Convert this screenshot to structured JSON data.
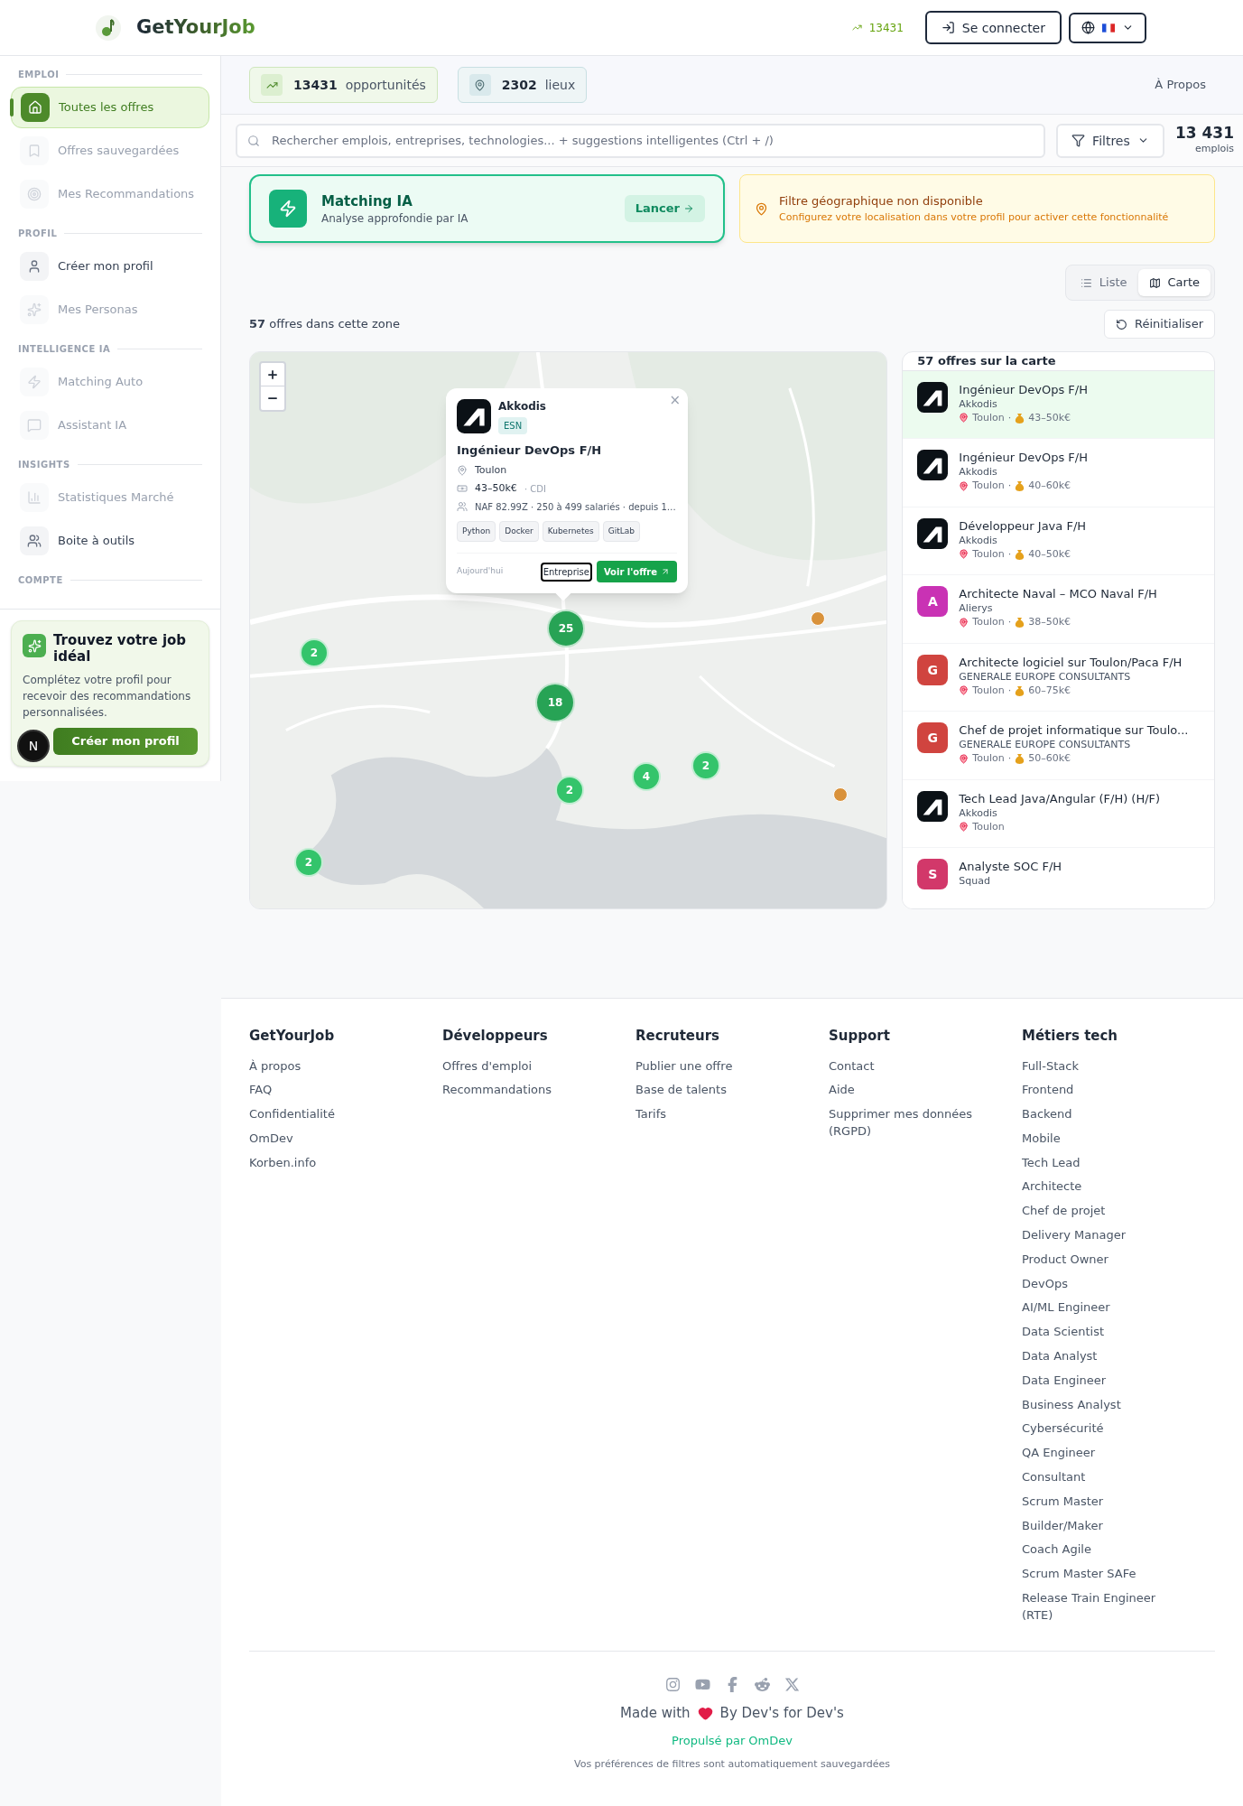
{
  "header": {
    "brand": "GetYourJob",
    "counter": "13431",
    "login": "Se connecter"
  },
  "sidebar": {
    "sections": [
      {
        "title": "EMPLOI",
        "items": [
          {
            "label": "Toutes les offres",
            "selected": true,
            "disabled": false
          },
          {
            "label": "Offres sauvegardées",
            "selected": false,
            "disabled": true
          },
          {
            "label": "Mes Recommandations",
            "selected": false,
            "disabled": true
          }
        ]
      },
      {
        "title": "PROFIL",
        "items": [
          {
            "label": "Créer mon profil",
            "selected": false,
            "disabled": false
          },
          {
            "label": "Mes Personas",
            "selected": false,
            "disabled": true
          }
        ]
      },
      {
        "title": "INTELLIGENCE IA",
        "items": [
          {
            "label": "Matching Auto",
            "selected": false,
            "disabled": true
          },
          {
            "label": "Assistant IA",
            "selected": false,
            "disabled": true
          }
        ]
      },
      {
        "title": "INSIGHTS",
        "items": [
          {
            "label": "Statistiques Marché",
            "selected": false,
            "disabled": true
          },
          {
            "label": "Boite à outils",
            "selected": false,
            "disabled": false
          }
        ]
      },
      {
        "title": "COMPTE"
      }
    ],
    "promo": {
      "title": "Trouvez votre job idéal",
      "text": "Complétez votre profil pour recevoir des recommandations personnalisées.",
      "button": "Créer mon profil"
    },
    "dev_badge": "N"
  },
  "stats": [
    {
      "value": "13431",
      "label": "opportunités"
    },
    {
      "value": "2302",
      "label": "lieux"
    }
  ],
  "about_link": "À Propos",
  "search": {
    "placeholder": "Rechercher emplois, entreprises, technologies... + suggestions intelligentes (Ctrl + /)",
    "filters": "Filtres",
    "total": "13 431",
    "total_label": "emplois"
  },
  "matching": {
    "title": "Matching IA",
    "subtitle": "Analyse approfondie par IA",
    "button": "Lancer"
  },
  "alert": {
    "title": "Filtre géographique non disponible",
    "text": "Configurez votre localisation dans votre profil pour activer cette fonctionnalité"
  },
  "view_toggle": [
    {
      "label": "Liste",
      "selected": false
    },
    {
      "label": "Carte",
      "selected": true
    }
  ],
  "results_count": "**57** offres dans cette zone",
  "reset": "Réinitialiser",
  "map": {
    "pins": [
      {
        "kind": "cluster",
        "count": "25"
      },
      {
        "kind": "cluster",
        "count": "2"
      },
      {
        "kind": "cluster",
        "count": "18"
      },
      {
        "kind": "cluster",
        "count": "2"
      },
      {
        "kind": "cluster",
        "count": "4"
      },
      {
        "kind": "cluster",
        "count": "2"
      },
      {
        "kind": "cluster",
        "count": "2"
      },
      {
        "kind": "single"
      },
      {
        "kind": "single"
      }
    ],
    "popup": {
      "company": "Akkodis",
      "tag": "ESN",
      "title": "Ingénieur DevOps F/H",
      "location": "Toulon",
      "salary": "43–50k€",
      "contract": "· CDI",
      "details": "NAF 82.99Z · 250 à 499 salariés · depuis 1…",
      "skills": [
        "Python",
        "Docker",
        "Kubernetes",
        "GitLab"
      ],
      "date": "Aujourd'hui",
      "company_button": "Entreprise",
      "offer_button": "Voir l'offre",
      "close": "×"
    }
  },
  "list": {
    "title": "57 offres sur la carte",
    "separator": "·",
    "items": [
      {
        "title": "Ingénieur DevOps F/H",
        "company": "Akkodis",
        "location": "Toulon",
        "salary": "43–50k€",
        "selected": true,
        "logo": {
          "kind": "mark"
        }
      },
      {
        "title": "Ingénieur DevOps F/H",
        "company": "Akkodis",
        "location": "Toulon",
        "salary": "40–60k€",
        "selected": false,
        "logo": {
          "kind": "mark"
        }
      },
      {
        "title": "Développeur Java F/H",
        "company": "Akkodis",
        "location": "Toulon",
        "salary": "40–50k€",
        "selected": false,
        "logo": {
          "kind": "mark"
        }
      },
      {
        "title": "Architecte Naval – MCO Naval F/H",
        "company": "Alierys",
        "location": "Toulon",
        "salary": "38–50k€",
        "selected": false,
        "logo": {
          "kind": "letter",
          "letter": "A",
          "color": "#c932b4"
        }
      },
      {
        "title": "Architecte logiciel sur Toulon/Paca F/H",
        "company": "GENERALE EUROPE CONSULTANTS",
        "location": "Toulon",
        "salary": "60–75k€",
        "selected": false,
        "logo": {
          "kind": "letter",
          "letter": "G",
          "color": "#d0443f"
        }
      },
      {
        "title": "Chef de projet informatique sur Toulo...",
        "company": "GENERALE EUROPE CONSULTANTS",
        "location": "Toulon",
        "salary": "50–60k€",
        "selected": false,
        "logo": {
          "kind": "letter",
          "letter": "G",
          "color": "#d0443f"
        }
      },
      {
        "title": "Tech Lead Java/Angular (F/H) (H/F)",
        "company": "Akkodis",
        "location": "Toulon",
        "selected": false,
        "logo": {
          "kind": "mark"
        }
      },
      {
        "title": "Analyste SOC F/H",
        "company": "Squad",
        "selected": false,
        "logo": {
          "kind": "letter",
          "letter": "S",
          "color": "#d2386a"
        }
      }
    ]
  },
  "footer": {
    "columns": [
      {
        "title": "GetYourJob",
        "links": [
          "À propos",
          "FAQ",
          "Confidentialité",
          "OmDev",
          "Korben.info"
        ]
      },
      {
        "title": "Développeurs",
        "links": [
          "Offres d'emploi",
          "Recommandations"
        ]
      },
      {
        "title": "Recruteurs",
        "links": [
          "Publier une offre",
          "Base de talents",
          "Tarifs"
        ]
      },
      {
        "title": "Support",
        "links": [
          "Contact",
          "Aide",
          "Supprimer mes données (RGPD)"
        ]
      },
      {
        "title": "Métiers tech",
        "links": [
          "Full-Stack",
          "Frontend",
          "Backend",
          "Mobile",
          "Tech Lead",
          "Architecte",
          "Chef de projet",
          "Delivery Manager",
          "Product Owner",
          "DevOps",
          "AI/ML Engineer",
          "Data Scientist",
          "Data Analyst",
          "Data Engineer",
          "Business Analyst",
          "Cybersécurité",
          "QA Engineer",
          "Consultant",
          "Scrum Master",
          "Builder/Maker",
          "Coach Agile",
          "Scrum Master SAFe",
          "Release Train Engineer (RTE)"
        ]
      }
    ],
    "made_with": "Made with",
    "made_by": "By Dev's for Dev's",
    "powered": "Propulsé par OmDev",
    "note": "Vos préférences de filtres sont automatiquement sauvegardées"
  }
}
